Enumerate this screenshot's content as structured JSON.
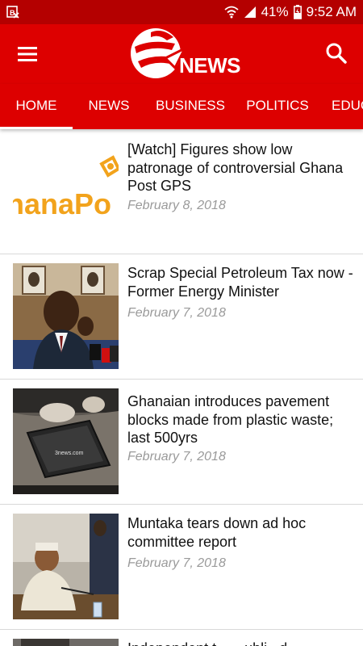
{
  "status_bar": {
    "notification_icon": "gallery-notification-icon",
    "wifi_icon": "wifi-icon",
    "signal_icon": "cell-signal-icon",
    "battery_percent": "41%",
    "battery_icon": "battery-charging-icon",
    "time": "9:52 AM"
  },
  "app_bar": {
    "menu_icon": "hamburger-menu-icon",
    "logo_text": "NEWS",
    "search_icon": "search-icon",
    "brand_color": "#dd0000"
  },
  "tabs": [
    {
      "label": "HOME",
      "active": true
    },
    {
      "label": "NEWS",
      "active": false
    },
    {
      "label": "BUSINESS",
      "active": false
    },
    {
      "label": "POLITICS",
      "active": false
    },
    {
      "label": "EDUC",
      "active": false
    }
  ],
  "articles": [
    {
      "headline": "[Watch] Figures show low patronage of controversial Ghana Post GPS",
      "date": "February 8, 2018",
      "thumb_text": "hanaPo"
    },
    {
      "headline": "Scrap Special Petroleum Tax now - Former Energy Minister",
      "date": "February 7, 2018"
    },
    {
      "headline": "Ghanaian introduces pavement blocks made from plastic waste; last 500yrs",
      "date": "February 7, 2018",
      "thumb_text": "3news.com"
    },
    {
      "headline": "Muntaka tears down ad hoc committee report",
      "date": "February 7, 2018"
    },
    {
      "headline": "Independent t... ...ubli...d...",
      "date": ""
    }
  ]
}
